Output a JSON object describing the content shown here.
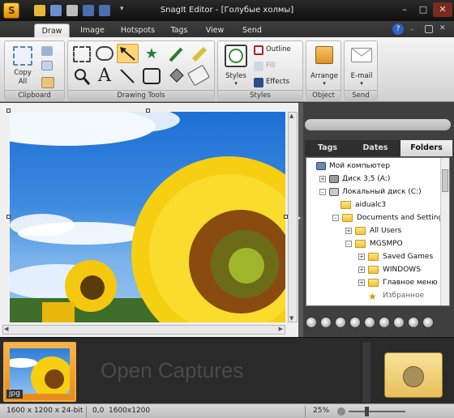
{
  "window": {
    "title": "SnagIt Editor - [Голубые холмы]"
  },
  "tabs": [
    "Draw",
    "Image",
    "Hotspots",
    "Tags",
    "View",
    "Send"
  ],
  "ribbon": {
    "clipboard": {
      "copy_all_label1": "Copy",
      "copy_all_label2": "All",
      "group_label": "Clipboard"
    },
    "drawing_tools": {
      "group_label": "Drawing Tools"
    },
    "styles": {
      "styles_label": "Styles",
      "outline_label": "Outline",
      "fill_label": "Fill",
      "effects_label": "Effects",
      "group_label": "Styles"
    },
    "object": {
      "arrange_label": "Arrange",
      "group_label": "Object"
    },
    "send": {
      "email_label": "E-mail",
      "group_label": "Send"
    }
  },
  "panel": {
    "tabs": [
      "Tags",
      "Dates",
      "Folders"
    ],
    "active_tab": "Folders",
    "tree": [
      {
        "label": "Мой компьютер",
        "icon": "computer-icon"
      },
      {
        "label": "Диск 3,5 (A:)",
        "icon": "floppy-icon"
      },
      {
        "label": "Локальный диск (C:)",
        "icon": "drive-icon"
      },
      {
        "label": "aidualc3",
        "icon": "folder-icon"
      },
      {
        "label": "Documents and Settings",
        "icon": "folder-icon"
      },
      {
        "label": "All Users",
        "icon": "folder-icon"
      },
      {
        "label": "MGSMPO",
        "icon": "folder-icon"
      },
      {
        "label": "Saved Games",
        "icon": "folder-icon"
      },
      {
        "label": "WINDOWS",
        "icon": "folder-icon"
      },
      {
        "label": "Главное меню",
        "icon": "folder-icon"
      },
      {
        "label": "Избранное",
        "icon": "star-folder-icon"
      }
    ]
  },
  "tray": {
    "thumb_label": "jpg",
    "open_captures": "Open Captures"
  },
  "status": {
    "dimensions": "1600 x 1200 x 24-bit",
    "coords": "0,0",
    "size": "1600x1200",
    "zoom": "25%"
  },
  "colors": {
    "accent": "#f5a93a",
    "titlebar": "#1a1a1a"
  }
}
